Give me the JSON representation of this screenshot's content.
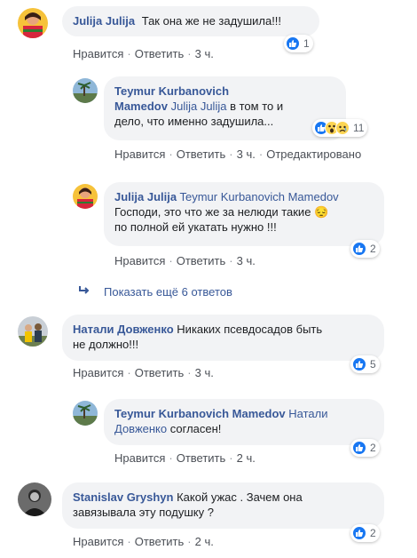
{
  "comments": [
    {
      "author": "Julija Julija",
      "text": "Так она же не задушила!!!",
      "reactions": "1",
      "actions": {
        "like": "Нравится",
        "reply": "Ответить",
        "time": "3 ч."
      }
    },
    {
      "author_line1": "Teymur Kurbanovich",
      "author_line2": "Mamedov",
      "mention": "Julija Julija",
      "text_line1": "в том то и",
      "text_line2": "дело, что именно задушила...",
      "reactions": "11",
      "actions": {
        "like": "Нравится",
        "reply": "Ответить",
        "time": "3 ч.",
        "edited": "Отредактировано"
      }
    },
    {
      "author": "Julija Julija",
      "mention": "Teymur Kurbanovich Mamedov",
      "text_line1": "Господи, это что же за нелюди такие",
      "text_line2": "по полной ей укатать нужно !!!",
      "emoji": "😔",
      "reactions": "2",
      "actions": {
        "like": "Нравится",
        "reply": "Ответить",
        "time": "3 ч."
      }
    },
    {
      "author": "Натали Довженко",
      "text_line1": "Никаких псевдосадов быть",
      "text_line2": "не должно!!!",
      "reactions": "5",
      "actions": {
        "like": "Нравится",
        "reply": "Ответить",
        "time": "3 ч."
      }
    },
    {
      "author": "Teymur Kurbanovich Mamedov",
      "mention_line1": "Натали",
      "mention_line2": "Довженко",
      "text": "согласен!",
      "reactions": "2",
      "actions": {
        "like": "Нравится",
        "reply": "Ответить",
        "time": "2 ч."
      }
    },
    {
      "author": "Stanislav Gryshyn",
      "text_line1": "Какой ужас . Зачем она",
      "text_line2": "завязывала эту подушку ?",
      "reactions": "2",
      "actions": {
        "like": "Нравится",
        "reply": "Ответить",
        "time": "2 ч."
      }
    }
  ],
  "more_replies": "Показать ещё 6 ответов",
  "separator": "·",
  "colors": {
    "link": "#385898",
    "bubble": "#f2f3f5",
    "like": "#1877f2"
  }
}
